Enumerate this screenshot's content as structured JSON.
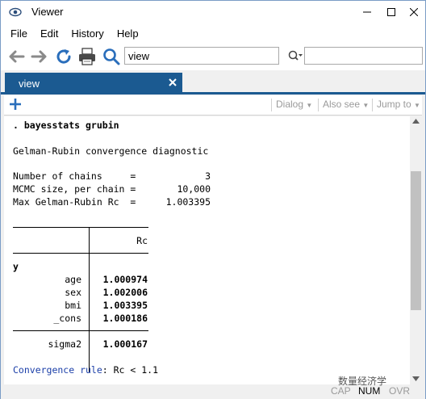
{
  "window": {
    "title": "Viewer"
  },
  "menu": [
    "File",
    "Edit",
    "History",
    "Help"
  ],
  "toolbar": {
    "address_value": "view",
    "search_value": ""
  },
  "tab": {
    "label": "view"
  },
  "viewer_toolbar": {
    "dialog": "Dialog",
    "also_see": "Also see",
    "jump_to": "Jump to"
  },
  "output": {
    "command": ". bayesstats grubin",
    "heading": "Gelman-Rubin convergence diagnostic",
    "stats": [
      {
        "label": "Number of chains     =",
        "value": "3"
      },
      {
        "label": "MCMC size, per chain =",
        "value": "10,000"
      },
      {
        "label": "Max Gelman-Rubin Rc  =",
        "value": "1.003395"
      }
    ],
    "table": {
      "column_header": "Rc",
      "group": "y",
      "rows": [
        {
          "name": "age",
          "value": "1.000974"
        },
        {
          "name": "sex",
          "value": "1.002006"
        },
        {
          "name": "bmi",
          "value": "1.003395"
        },
        {
          "name": "_cons",
          "value": "1.000186"
        }
      ],
      "extra_row": {
        "name": "sigma2",
        "value": "1.000167"
      }
    },
    "rule_link": "Convergence rule",
    "rule_rest": ": Rc < 1.1"
  },
  "status": {
    "cap": "CAP",
    "num": "NUM",
    "ovr": "OVR"
  },
  "watermark": "数量经济学",
  "colors": {
    "tab_blue": "#1b5a91",
    "link_blue": "#1a3ea8",
    "toolbar_icon_blue": "#2a6ebb"
  }
}
